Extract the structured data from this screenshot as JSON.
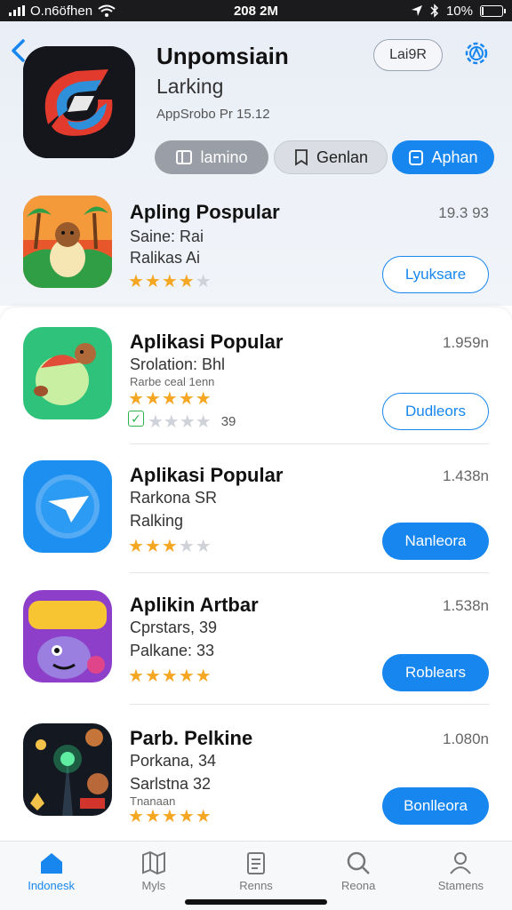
{
  "status_bar": {
    "carrier": "O.n6öfhen",
    "time": "208 2M",
    "battery": "10%"
  },
  "hero": {
    "title": "Unpomsiain",
    "subtitle": "Larking",
    "meta": "AppSrobo Pr 15.12",
    "pill_label": "Lai9R",
    "chips": [
      {
        "label": "lamino",
        "icon": "book-icon"
      },
      {
        "label": "Genlan",
        "icon": "bookmark-icon"
      },
      {
        "label": "Aphan",
        "icon": "lock-icon"
      }
    ]
  },
  "featured": {
    "name": "Apling Pospular",
    "line1": "Saine: Rai",
    "line2": "Ralikas Ai",
    "rating": 3.5,
    "size": "19.3 93",
    "button": "Lyuksare"
  },
  "apps": [
    {
      "name": "Aplikasi Popular",
      "line1": "Srolation: Bhl",
      "line2": "Rarbe ceal 1enn",
      "rating": 5,
      "count": "39",
      "size": "1.959n",
      "button": "Dudleors",
      "button_style": "outline"
    },
    {
      "name": "Aplikasi Popular",
      "line1": "Rarkona SR",
      "line2": "Ralking",
      "rating": 3,
      "size": "1.438n",
      "button": "Nanleora",
      "button_style": "solid"
    },
    {
      "name": "Aplikin Artbar",
      "line1": "Cprstars, 39",
      "line2": "Palkane: 33",
      "rating": 4.5,
      "size": "1.538n",
      "button": "Roblears",
      "button_style": "solid"
    },
    {
      "name": "Parb. Pelkine",
      "line1": "Porkana, 34",
      "line2": "Sarlstna 32",
      "line3": "Tnanaan",
      "rating": 4.5,
      "size": "1.080n",
      "button": "Bonlleora",
      "button_style": "solid"
    }
  ],
  "tabs": [
    {
      "label": "Indonesk",
      "icon": "home-icon",
      "active": true
    },
    {
      "label": "Myls",
      "icon": "map-icon",
      "active": false
    },
    {
      "label": "Renns",
      "icon": "clipboard-icon",
      "active": false
    },
    {
      "label": "Reona",
      "icon": "search-icon",
      "active": false
    },
    {
      "label": "Stamens",
      "icon": "person-icon",
      "active": false
    }
  ],
  "colors": {
    "accent": "#1786ee",
    "star": "#f5a623",
    "header_bg": "#e9eef6"
  }
}
